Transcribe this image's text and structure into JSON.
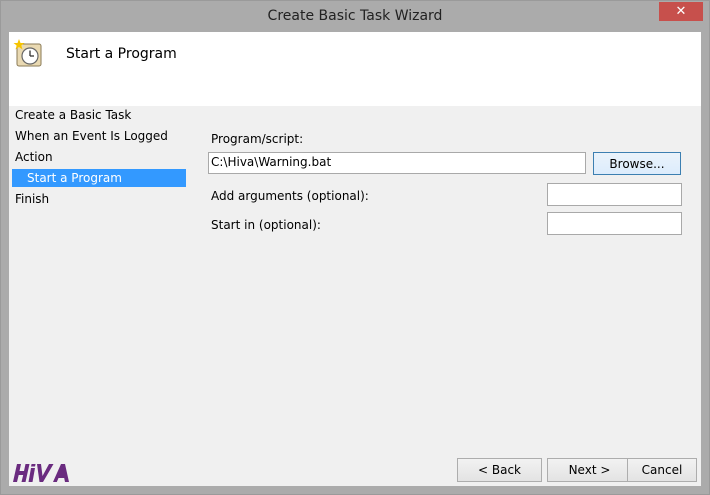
{
  "window": {
    "title": "Create Basic Task Wizard",
    "close_glyph": "✕"
  },
  "header": {
    "title": "Start a Program",
    "icon": "scheduled-task-clock-icon"
  },
  "steps": [
    {
      "label": "Create a Basic Task"
    },
    {
      "label": "When an Event Is Logged"
    },
    {
      "label": "Action"
    },
    {
      "label": "Start a Program"
    },
    {
      "label": "Finish"
    }
  ],
  "form": {
    "program_label": "Program/script:",
    "program_value": "C:\\Hiva\\Warning.bat",
    "browse_label": "Browse...",
    "arguments_label": "Add arguments (optional):",
    "arguments_value": "",
    "start_in_label": "Start in (optional):",
    "start_in_value": ""
  },
  "footer": {
    "back_label": "< Back",
    "next_label": "Next >",
    "cancel_label": "Cancel"
  },
  "colors": {
    "selection": "#3399ff",
    "logo": "#6a2b7f",
    "close": "#c7504c"
  }
}
